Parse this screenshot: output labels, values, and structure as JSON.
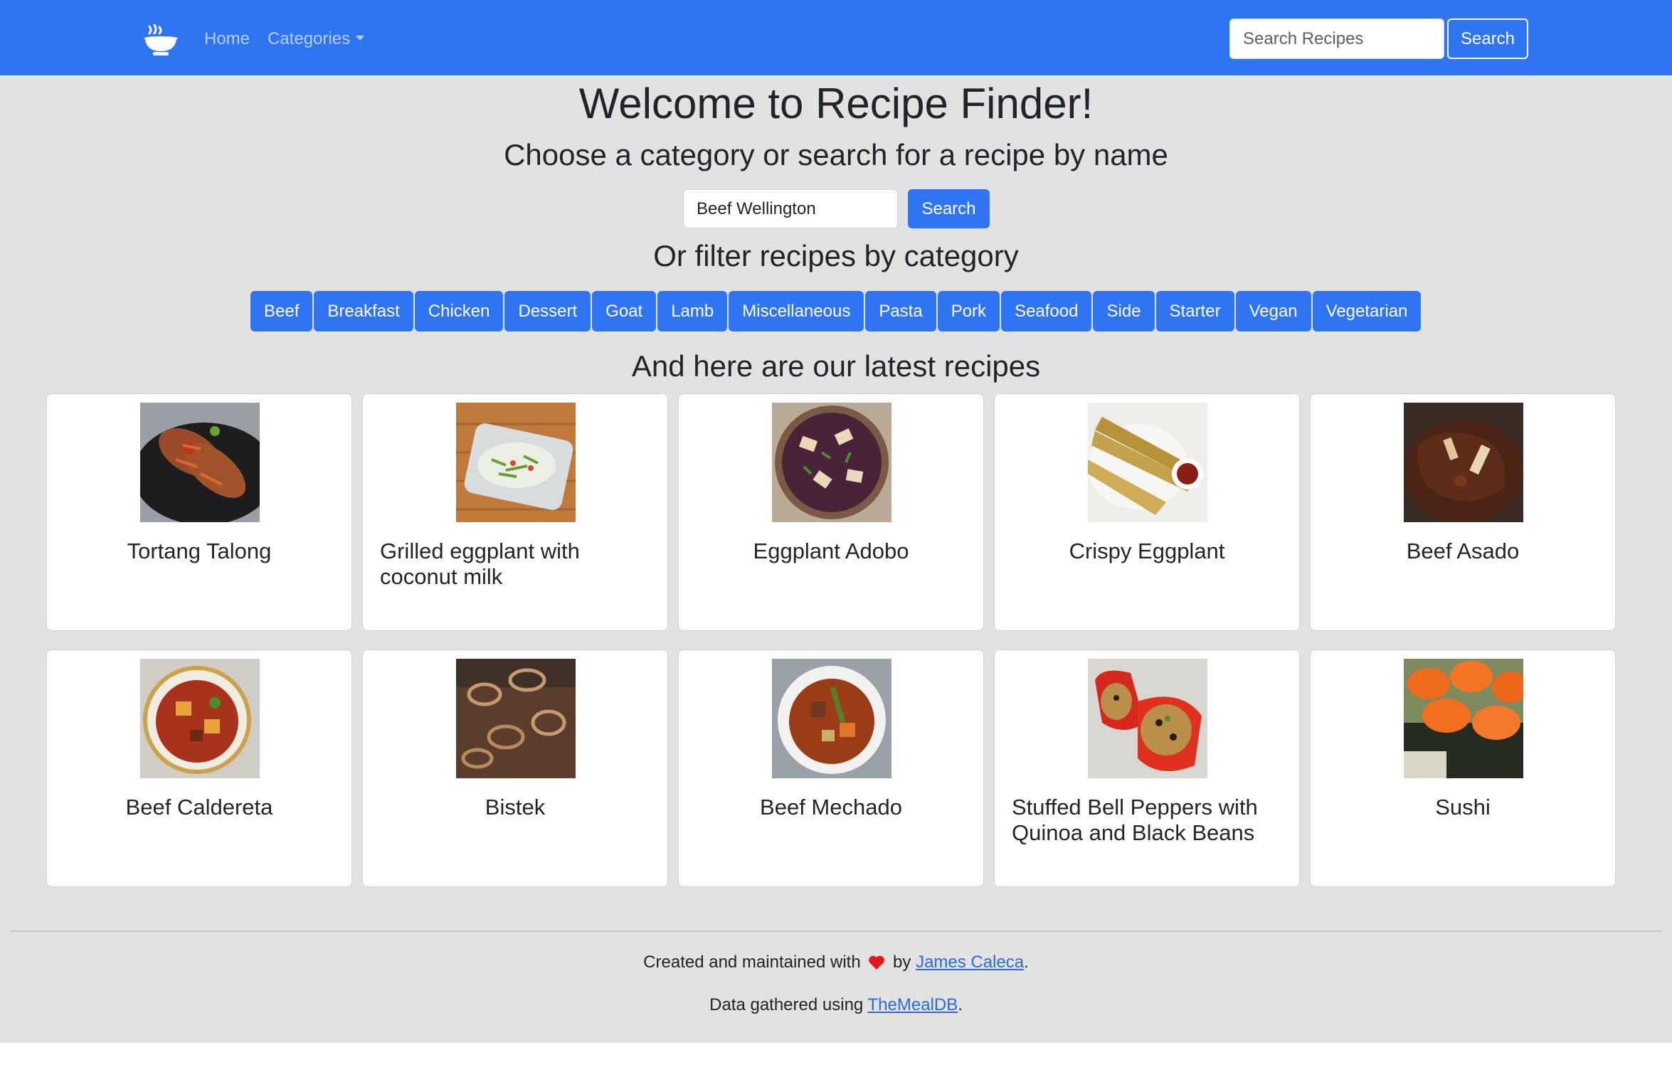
{
  "nav": {
    "home": "Home",
    "categories": "Categories",
    "search_placeholder": "Search Recipes",
    "search_button": "Search"
  },
  "hero": {
    "title": "Welcome to Recipe Finder!",
    "subtitle": "Choose a category or search for a recipe by name",
    "search_value": "Beef Wellington",
    "search_button": "Search",
    "filter_heading": "Or filter recipes by category",
    "latest_heading": "And here are our latest recipes"
  },
  "categories": [
    "Beef",
    "Breakfast",
    "Chicken",
    "Dessert",
    "Goat",
    "Lamb",
    "Miscellaneous",
    "Pasta",
    "Pork",
    "Seafood",
    "Side",
    "Starter",
    "Vegan",
    "Vegetarian"
  ],
  "recipes": [
    {
      "title": "Tortang Talong",
      "image": "omelette-plate"
    },
    {
      "title": "Grilled eggplant with coconut milk",
      "image": "eggplant-dish"
    },
    {
      "title": "Eggplant Adobo",
      "image": "adobo-bowl"
    },
    {
      "title": "Crispy Eggplant",
      "image": "fried-strips"
    },
    {
      "title": "Beef Asado",
      "image": "stew-bowl"
    },
    {
      "title": "Beef Caldereta",
      "image": "caldereta-bowl"
    },
    {
      "title": "Bistek",
      "image": "onion-rings"
    },
    {
      "title": "Beef Mechado",
      "image": "mechado-bowl"
    },
    {
      "title": "Stuffed Bell Peppers with Quinoa and Black Beans",
      "image": "stuffed-peppers"
    },
    {
      "title": "Sushi",
      "image": "sushi-rolls"
    }
  ],
  "footer": {
    "line1_prefix": "Created and maintained with",
    "line1_by": "by",
    "author": "James Caleca",
    "line1_suffix": ".",
    "line2_prefix": "Data gathered using",
    "source": "TheMealDB",
    "line2_suffix": "."
  },
  "colors": {
    "primary": "#2f74f2",
    "page_bg": "#e2e2e2",
    "heart": "#e0191e"
  }
}
